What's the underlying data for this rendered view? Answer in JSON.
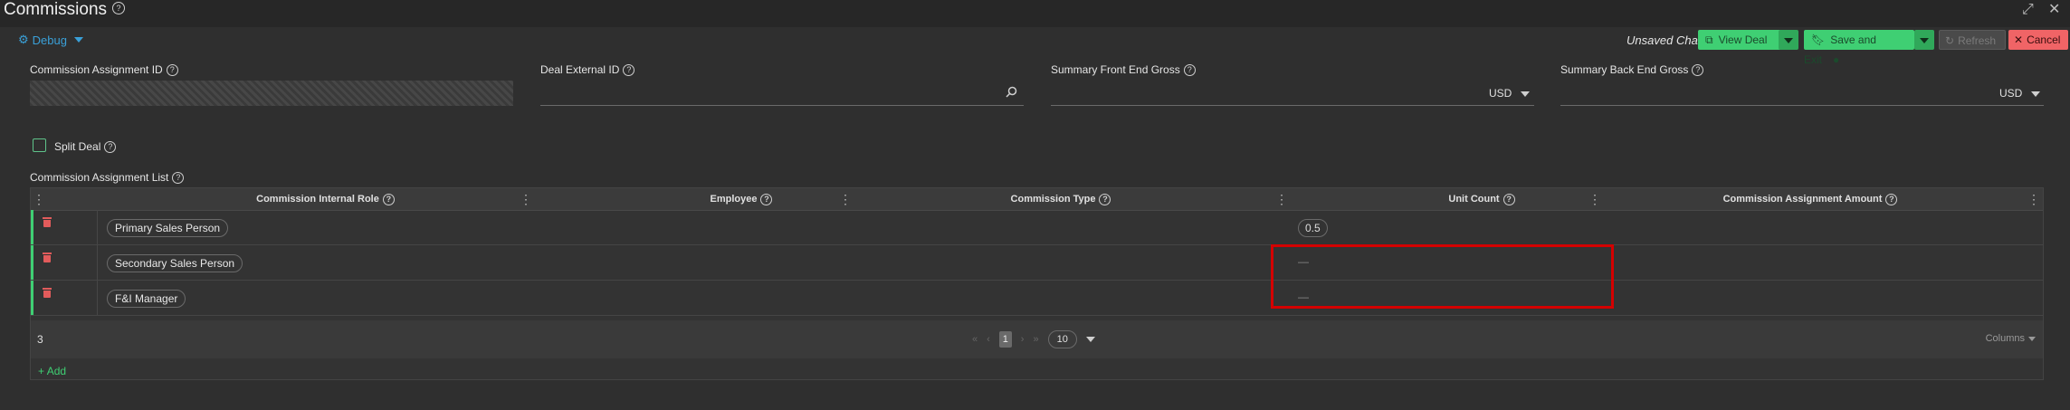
{
  "window": {
    "title": "Commissions"
  },
  "toolbar": {
    "debug_label": "Debug",
    "unsaved_text": "Unsaved Changes",
    "view_deal": "View Deal",
    "save_and_exit": "Save and Exit",
    "refresh": "Refresh",
    "cancel": "Cancel"
  },
  "fields": {
    "commission_assignment_id": {
      "label": "Commission Assignment ID",
      "value": ""
    },
    "deal_external_id": {
      "label": "Deal External ID",
      "value": ""
    },
    "summary_front_end_gross": {
      "label": "Summary Front End Gross",
      "currency": "USD"
    },
    "summary_back_end_gross": {
      "label": "Summary Back End Gross",
      "currency": "USD"
    }
  },
  "split_deal": {
    "label": "Split Deal",
    "checked": false
  },
  "list": {
    "label": "Commission Assignment List",
    "columns": [
      "Commission Internal Role",
      "Employee",
      "Commission Type",
      "Unit Count",
      "Commission Assignment Amount"
    ],
    "rows": [
      {
        "role": "Primary Sales Person",
        "unit_count": "0.5"
      },
      {
        "role": "Secondary Sales Person",
        "unit_count": "—"
      },
      {
        "role": "F&I Manager",
        "unit_count": "—"
      }
    ],
    "total_count": "3",
    "page": "1",
    "page_size": "10",
    "columns_button": "Columns",
    "add_button": "Add"
  },
  "colors": {
    "accent_green": "#3fcf73",
    "danger_red": "#f06466",
    "link_blue": "#3aa0d8",
    "highlight": "#d40000"
  }
}
